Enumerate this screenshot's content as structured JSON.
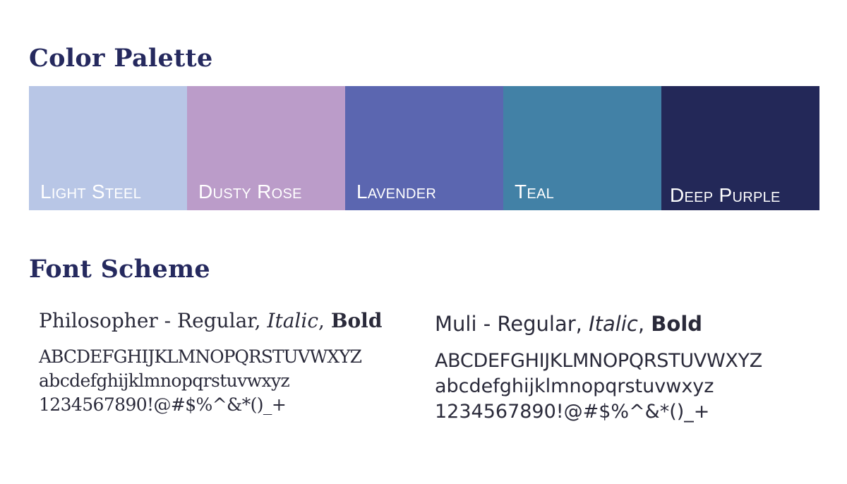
{
  "color_palette": {
    "title": "Color Palette",
    "swatches": [
      {
        "label": "Light Steel",
        "color": "#b8c6e6"
      },
      {
        "label": "Dusty Rose",
        "color": "#bb9cc9"
      },
      {
        "label": "Lavender",
        "color": "#5b66b0"
      },
      {
        "label": "Teal",
        "color": "#4281a6"
      },
      {
        "label": "Deep Purple",
        "color": "#232858"
      }
    ]
  },
  "font_scheme": {
    "title": "Font Scheme",
    "fonts": [
      {
        "name_prefix": "Philosopher - Regular, ",
        "italic": "Italic",
        "separator": ", ",
        "bold": "Bold",
        "uppercase": "ABCDEFGHIJKLMNOPQRSTUVWXYZ",
        "lowercase": "abcdefghijklmnopqrstuvwxyz",
        "symbols": "1234567890!@#$%^&*()_+"
      },
      {
        "name_prefix": "Muli - Regular, ",
        "italic": "Italic",
        "separator": ", ",
        "bold": "Bold",
        "uppercase": "ABCDEFGHIJKLMNOPQRSTUVWXYZ",
        "lowercase": "abcdefghijklmnopqrstuvwxyz",
        "symbols": "1234567890!@#$%^&*()_+"
      }
    ]
  }
}
